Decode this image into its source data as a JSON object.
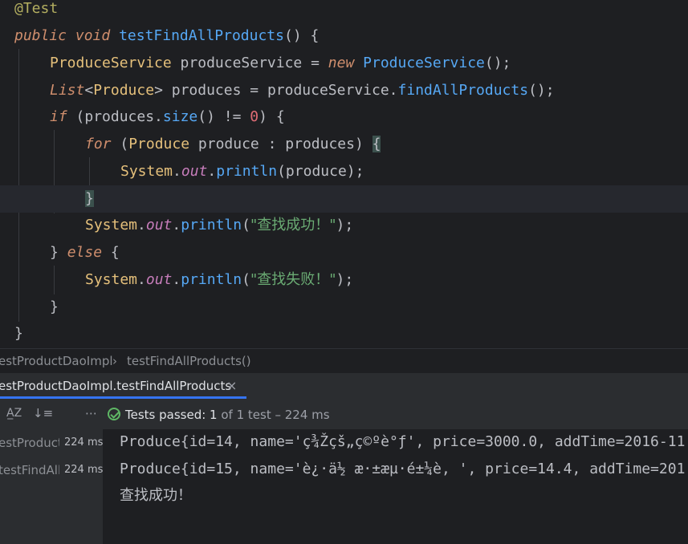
{
  "code": {
    "l1": {
      "ann": "@Test"
    },
    "l2": {
      "kw1": "public",
      "kw2": "void",
      "mth": "testFindAllProducts",
      "rest": "() {"
    },
    "l3": {
      "cls1": "ProduceService",
      "var": " produceService = ",
      "kw": "new",
      "cls2": "ProduceService",
      "rest": "();"
    },
    "l4": {
      "kw": "List",
      "lt": "<",
      "cls": "Produce",
      "gt": ">",
      "var": " produces = produceService.",
      "mth": "findAllProducts",
      "rest": "();"
    },
    "l5": {
      "kw": "if",
      "p1": " (produces.",
      "mth": "size",
      "p2": "() != ",
      "num": "0",
      "p3": ") {"
    },
    "l6": {
      "kw": "for",
      "p1": " (",
      "cls": "Produce",
      "p2": " produce : produces) ",
      "brace": "{"
    },
    "l7": {
      "sys": "System",
      "dot1": ".",
      "fld": "out",
      "dot2": ".",
      "mth": "println",
      "rest": "(produce);"
    },
    "l8": {
      "brace": "}"
    },
    "l9": {
      "sys": "System",
      "dot1": ".",
      "fld": "out",
      "dot2": ".",
      "mth": "println",
      "p1": "(",
      "str": "\"查找成功！\"",
      "p2": ");"
    },
    "l10": {
      "p1": "} ",
      "kw": "else",
      "p2": " {"
    },
    "l11": {
      "sys": "System",
      "dot1": ".",
      "fld": "out",
      "dot2": ".",
      "mth": "println",
      "p1": "(",
      "str": "\"查找失败！\"",
      "p2": ");"
    },
    "l12": {
      "brace": "}"
    },
    "l13": {
      "brace": "}"
    }
  },
  "breadcrumb": {
    "class": "estProductDaoImpl",
    "sep": "›",
    "method": "testFindAllProducts()"
  },
  "run_tab": {
    "label": "estProductDaoImpl.testFindAllProducts",
    "close": "×"
  },
  "toolbar": {
    "sort_alpha": "A̲Z",
    "sort_duration": "↓≡",
    "more": "⋯",
    "status_passed": "Tests passed:",
    "status_count": " 1",
    "status_rest": " of 1 test – 224 ms"
  },
  "tree": [
    {
      "name": "estProductD",
      "time": "224 ms"
    },
    {
      "name": "testFindAll",
      "time": "224 ms"
    }
  ],
  "console": [
    "Produce{id=14, name='ç¾Žçš„ç©ºè°ƒ', price=3000.0, addTime=2016-11",
    "Produce{id=15, name='è¿·ä½ æ·±æµ·é±¼è, ', price=14.4, addTime=201",
    "查找成功！"
  ]
}
